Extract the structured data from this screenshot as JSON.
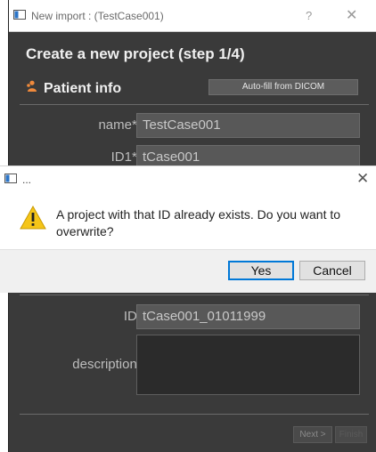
{
  "background_window": {
    "title": "New import : (TestCase001)",
    "help": "?",
    "close": "✕",
    "heading": "Create a new project (step 1/4)",
    "section": "Patient info",
    "autofill_label": "Auto-fill from DICOM",
    "fields": {
      "name_label": "name*:",
      "name_value": "TestCase001",
      "id1_label": "ID1*:",
      "id1_value": "tCase001",
      "id_label": "ID:",
      "id_value": "tCase001_01011999",
      "description_label": "description:",
      "description_value": ""
    },
    "next_label": "Next >",
    "finish_label": "Finish"
  },
  "dialog": {
    "title": "...",
    "close": "✕",
    "message": "A project with that ID already exists. Do you want to overwrite?",
    "yes_label": "Yes",
    "cancel_label": "Cancel",
    "icon": "warning-icon"
  },
  "colors": {
    "window_bg": "#3a3a3a",
    "accent": "#0078d7",
    "warning": "#f5c518",
    "patient_icon": "#f08a3c"
  }
}
